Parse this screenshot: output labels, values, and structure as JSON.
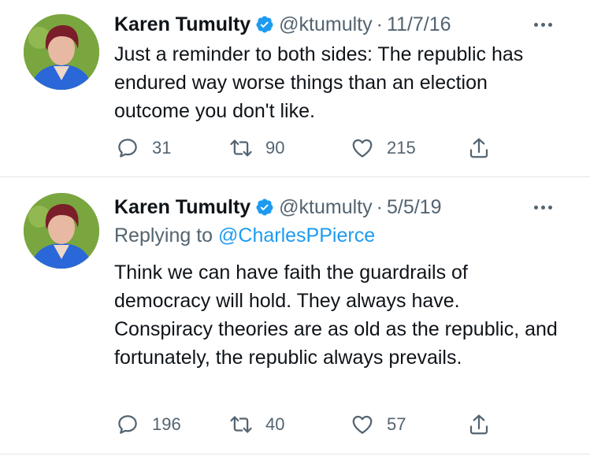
{
  "colors": {
    "text": "#0f1419",
    "secondary": "#536471",
    "link": "#1d9bf0",
    "verified": "#1d9bf0",
    "divider": "#e1e6ea"
  },
  "tweets": [
    {
      "author_name": "Karen Tumulty",
      "handle": "@ktumulty",
      "separator": "·",
      "date": "11/7/16",
      "body": "Just a reminder to both sides: The republic has endured way worse things than an election outcome you don't like.",
      "replies": "31",
      "retweets": "90",
      "likes": "215"
    },
    {
      "author_name": "Karen Tumulty",
      "handle": "@ktumulty",
      "separator": "·",
      "date": "5/5/19",
      "replying_prefix": "Replying to ",
      "replying_to": "@CharlesPPierce",
      "body": "Think we can have faith the guardrails of democracy will hold. They always have. Conspiracy theories are as old as the republic, and fortunately, the republic always prevails.",
      "replies": "196",
      "retweets": "40",
      "likes": "57"
    }
  ],
  "icons": {
    "verified": "verified-badge-icon",
    "more": "more-dots-icon",
    "reply": "reply-bubble-icon",
    "retweet": "retweet-icon",
    "like": "heart-icon",
    "share": "share-icon"
  }
}
